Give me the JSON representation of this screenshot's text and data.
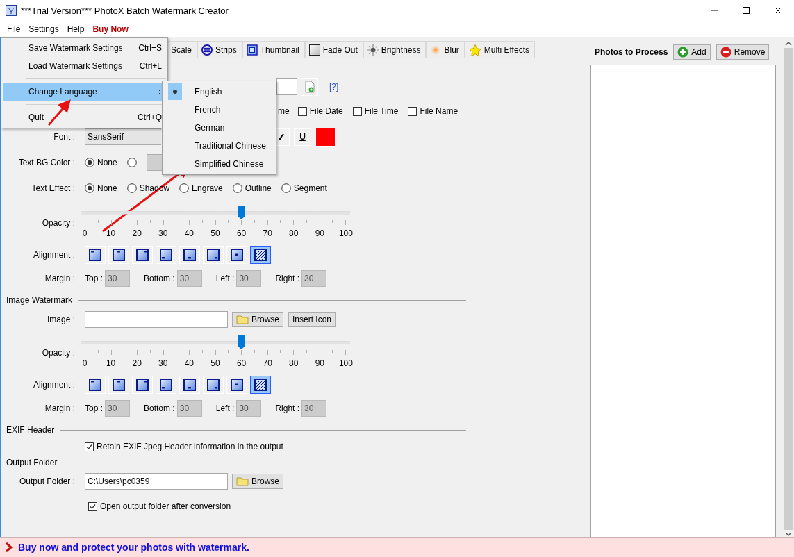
{
  "window": {
    "title": "***Trial Version*** PhotoX Batch Watermark Creator"
  },
  "menu_bar": [
    {
      "label": "File",
      "kind": "plain"
    },
    {
      "label": "Settings",
      "kind": "plain"
    },
    {
      "label": "Help",
      "kind": "plain"
    },
    {
      "label": "Buy Now",
      "kind": "promo"
    }
  ],
  "file_menu": [
    {
      "kind": "item",
      "label": "Save Watermark Settings",
      "shortcut": "Ctrl+S",
      "selected": false
    },
    {
      "kind": "item",
      "label": "Load Watermark Settings",
      "shortcut": "Ctrl+L",
      "selected": false
    },
    {
      "kind": "separator"
    },
    {
      "kind": "submenu",
      "label": "Change Language",
      "selected": true
    },
    {
      "kind": "separator"
    },
    {
      "kind": "item",
      "label": "Quit",
      "shortcut": "Ctrl+Q",
      "selected": false
    }
  ],
  "language_menu": [
    {
      "label": "English",
      "selected": true
    },
    {
      "label": "French",
      "selected": false
    },
    {
      "label": "German",
      "selected": false
    },
    {
      "label": "Traditional Chinese",
      "selected": false
    },
    {
      "label": "Simplified Chinese",
      "selected": false
    }
  ],
  "tabs": [
    {
      "label": "Scale",
      "kind": "plain",
      "selected": false
    },
    {
      "label": "Strips",
      "kind": "strips",
      "selected": false
    },
    {
      "label": "Thumbnail",
      "kind": "thumbnail",
      "selected": false
    },
    {
      "label": "Fade Out",
      "kind": "fade",
      "selected": false
    },
    {
      "label": "Brightness",
      "kind": "brightness",
      "selected": false
    },
    {
      "label": "Blur",
      "kind": "blur",
      "selected": false
    },
    {
      "label": "Multi Effects",
      "kind": "star",
      "selected": false
    }
  ],
  "text_watermark": {
    "help_link": "[?]",
    "stamp_label_tail": "me",
    "stamps": [
      {
        "label": "File Date",
        "checked": false
      },
      {
        "label": "File Time",
        "checked": false
      },
      {
        "label": "File Name",
        "checked": false
      }
    ],
    "font": {
      "label": "Font :",
      "value": "SansSerif"
    },
    "underline": "U",
    "bg_color": {
      "label": "Text BG Color :",
      "options": [
        {
          "label": "None",
          "selected": true
        },
        {
          "selected": false
        }
      ]
    },
    "effect": {
      "label": "Text Effect :",
      "options": [
        {
          "label": "None",
          "selected": true
        },
        {
          "label": "Shadow",
          "selected": false
        },
        {
          "label": "Engrave",
          "selected": false
        },
        {
          "label": "Outline",
          "selected": false
        },
        {
          "label": "Segment",
          "selected": false
        }
      ]
    },
    "opacity": {
      "label": "Opacity :",
      "level": 0.6,
      "ticks": [
        "0",
        "10",
        "20",
        "30",
        "40",
        "50",
        "60",
        "70",
        "80",
        "90",
        "100"
      ]
    },
    "alignment": {
      "label": "Alignment :",
      "options": [
        {
          "selected": false
        },
        {
          "selected": false
        },
        {
          "selected": false
        },
        {
          "selected": false
        },
        {
          "selected": false
        },
        {
          "selected": false
        },
        {
          "selected": false
        },
        {
          "selected": true
        }
      ]
    },
    "margin": {
      "label": "Margin :",
      "fields": [
        {
          "label": "Top :",
          "value": "30"
        },
        {
          "label": "Bottom :",
          "value": "30"
        },
        {
          "label": "Left :",
          "value": "30"
        },
        {
          "label": "Right :",
          "value": "30"
        }
      ]
    }
  },
  "image_watermark": {
    "title": "Image Watermark",
    "image_label": "Image :",
    "browse": "Browse",
    "insert_icon": "Insert Icon",
    "opacity": {
      "label": "Opacity :",
      "level": 0.6,
      "ticks": [
        "0",
        "10",
        "20",
        "30",
        "40",
        "50",
        "60",
        "70",
        "80",
        "90",
        "100"
      ]
    },
    "alignment": {
      "label": "Alignment :",
      "options": [
        {
          "selected": false
        },
        {
          "selected": false
        },
        {
          "selected": false
        },
        {
          "selected": false
        },
        {
          "selected": false
        },
        {
          "selected": false
        },
        {
          "selected": false
        },
        {
          "selected": true
        }
      ]
    },
    "margin": {
      "label": "Margin :",
      "fields": [
        {
          "label": "Top :",
          "value": "30"
        },
        {
          "label": "Bottom :",
          "value": "30"
        },
        {
          "label": "Left :",
          "value": "30"
        },
        {
          "label": "Right :",
          "value": "30"
        }
      ]
    }
  },
  "exif": {
    "title": "EXIF Header",
    "retain": {
      "label": "Retain EXIF Jpeg Header information in the output",
      "checked": true
    }
  },
  "output": {
    "title": "Output Folder",
    "label": "Output Folder :",
    "value": "C:\\Users\\pc0359",
    "browse": "Browse",
    "open_after": {
      "label": "Open output folder after conversion",
      "checked": true
    }
  },
  "photos": {
    "title": "Photos to Process",
    "add": "Add",
    "remove": "Remove"
  },
  "status_bar": {
    "message": "Buy now and protect your photos with watermark."
  }
}
